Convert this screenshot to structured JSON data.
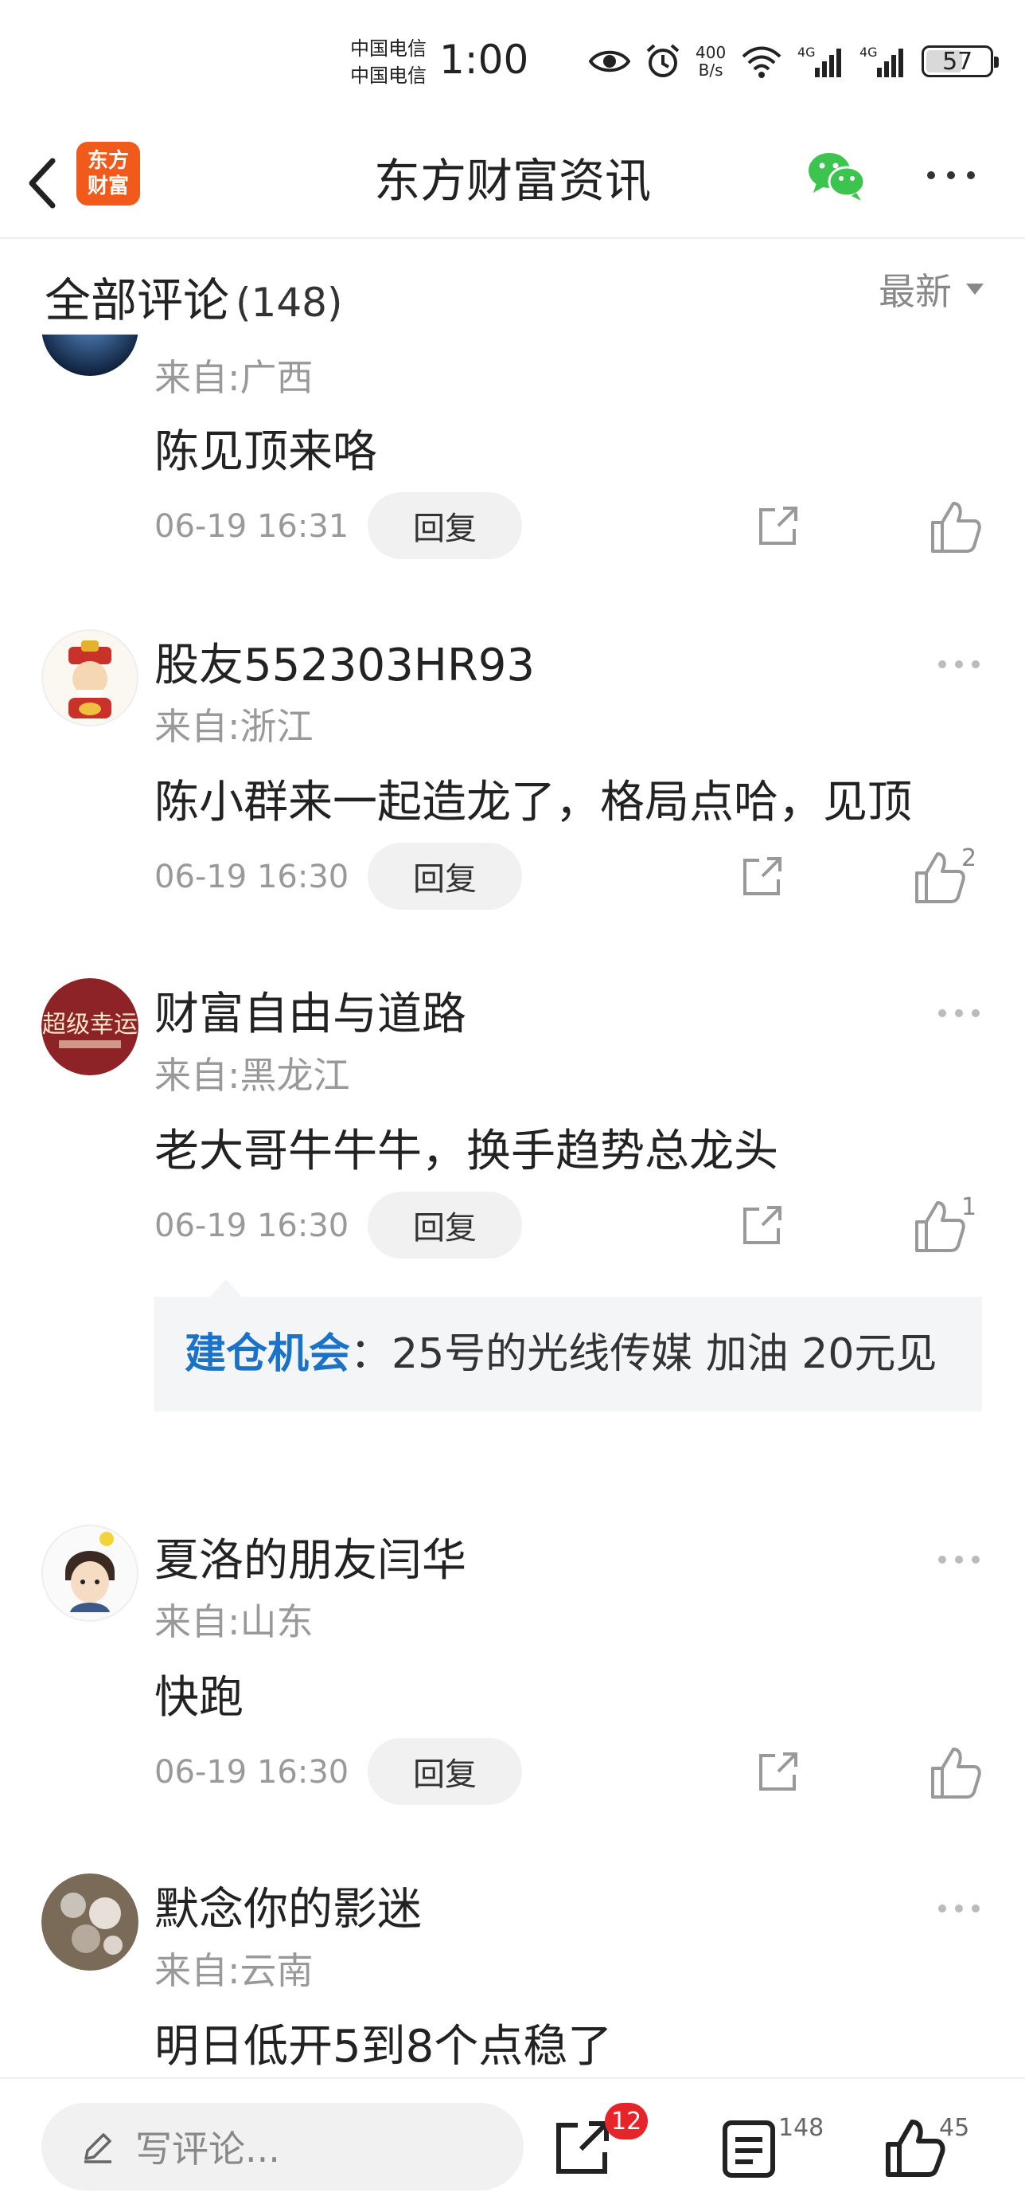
{
  "status_bar": {
    "carrier_1": "中国电信",
    "carrier_2": "中国电信",
    "time": "1:00",
    "net_speed_value": "400",
    "net_speed_unit": "B/s",
    "battery": "57",
    "battery_level": 0.57
  },
  "nav": {
    "logo_line1": "东方",
    "logo_line2": "财富",
    "title": "东方财富资讯",
    "logo_color": "#f25a1c",
    "wechat_color": "#3dc44f"
  },
  "comments_header": {
    "title": "全部评论",
    "count": "(148)",
    "sort_label": "最新"
  },
  "comments": [
    {
      "location": "来自:广西",
      "content": "陈见顶来咯",
      "time": "06-19 16:31",
      "reply_label": "回复",
      "likes": ""
    },
    {
      "username": "股友552303HR93",
      "location": "来自:浙江",
      "content": "陈小群来一起造龙了，格局点哈，见顶",
      "time": "06-19 16:30",
      "reply_label": "回复",
      "likes": "2"
    },
    {
      "username": "财富自由与道路",
      "location": "来自:黑龙江",
      "content": "老大哥牛牛牛，换手趋势总龙头",
      "time": "06-19 16:30",
      "reply_label": "回复",
      "likes": "1",
      "avatar_text": "超级幸运",
      "quote": {
        "author": "建仓机会",
        "text": "：25号的光线传媒 加油 20元见"
      }
    },
    {
      "username": "夏洛的朋友闫华",
      "location": "来自:山东",
      "content": "快跑",
      "time": "06-19 16:30",
      "reply_label": "回复",
      "likes": ""
    },
    {
      "username": "默念你的影迷",
      "location": "来自:云南",
      "content": "明日低开5到8个点稳了"
    }
  ],
  "bottom_bar": {
    "input_placeholder": "写评论...",
    "share_badge": "12",
    "comment_count": "148",
    "like_count": "45",
    "badge_color": "#e8242b"
  }
}
